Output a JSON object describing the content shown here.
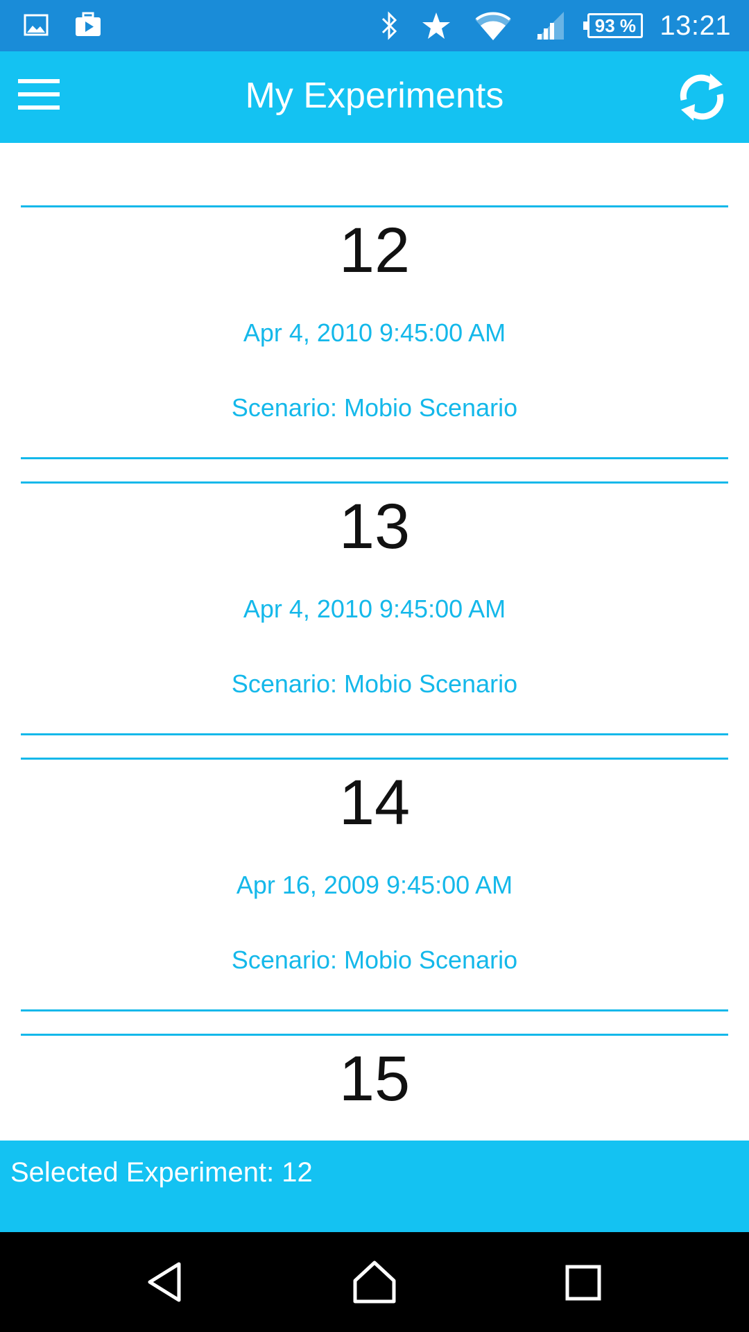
{
  "status_bar": {
    "left_icons": [
      "image-icon",
      "briefcase-play-icon"
    ],
    "right_icons": [
      "bluetooth-icon",
      "star-icon",
      "wifi-icon",
      "signal-icon"
    ],
    "battery": "93 %",
    "time": "13:21"
  },
  "app_bar": {
    "title": "My Experiments",
    "menu_icon": "hamburger-menu-icon",
    "refresh_icon": "refresh-icon"
  },
  "experiments": [
    {
      "id": "12",
      "date": "Apr 4, 2010 9:45:00 AM",
      "scenario": "Scenario: Mobio Scenario"
    },
    {
      "id": "13",
      "date": "Apr 4, 2010 9:45:00 AM",
      "scenario": "Scenario: Mobio Scenario"
    },
    {
      "id": "14",
      "date": "Apr 16, 2009 9:45:00 AM",
      "scenario": "Scenario: Mobio Scenario"
    },
    {
      "id": "15",
      "date": "",
      "scenario": ""
    }
  ],
  "selection": {
    "text": "Selected Experiment: 12"
  },
  "nav_bar": {
    "back_icon": "back-icon",
    "home_icon": "home-icon",
    "recents_icon": "recents-icon"
  },
  "colors": {
    "status_bar": "#1a8cd8",
    "accent": "#14c2f2",
    "text_accent": "#14b8ea"
  }
}
